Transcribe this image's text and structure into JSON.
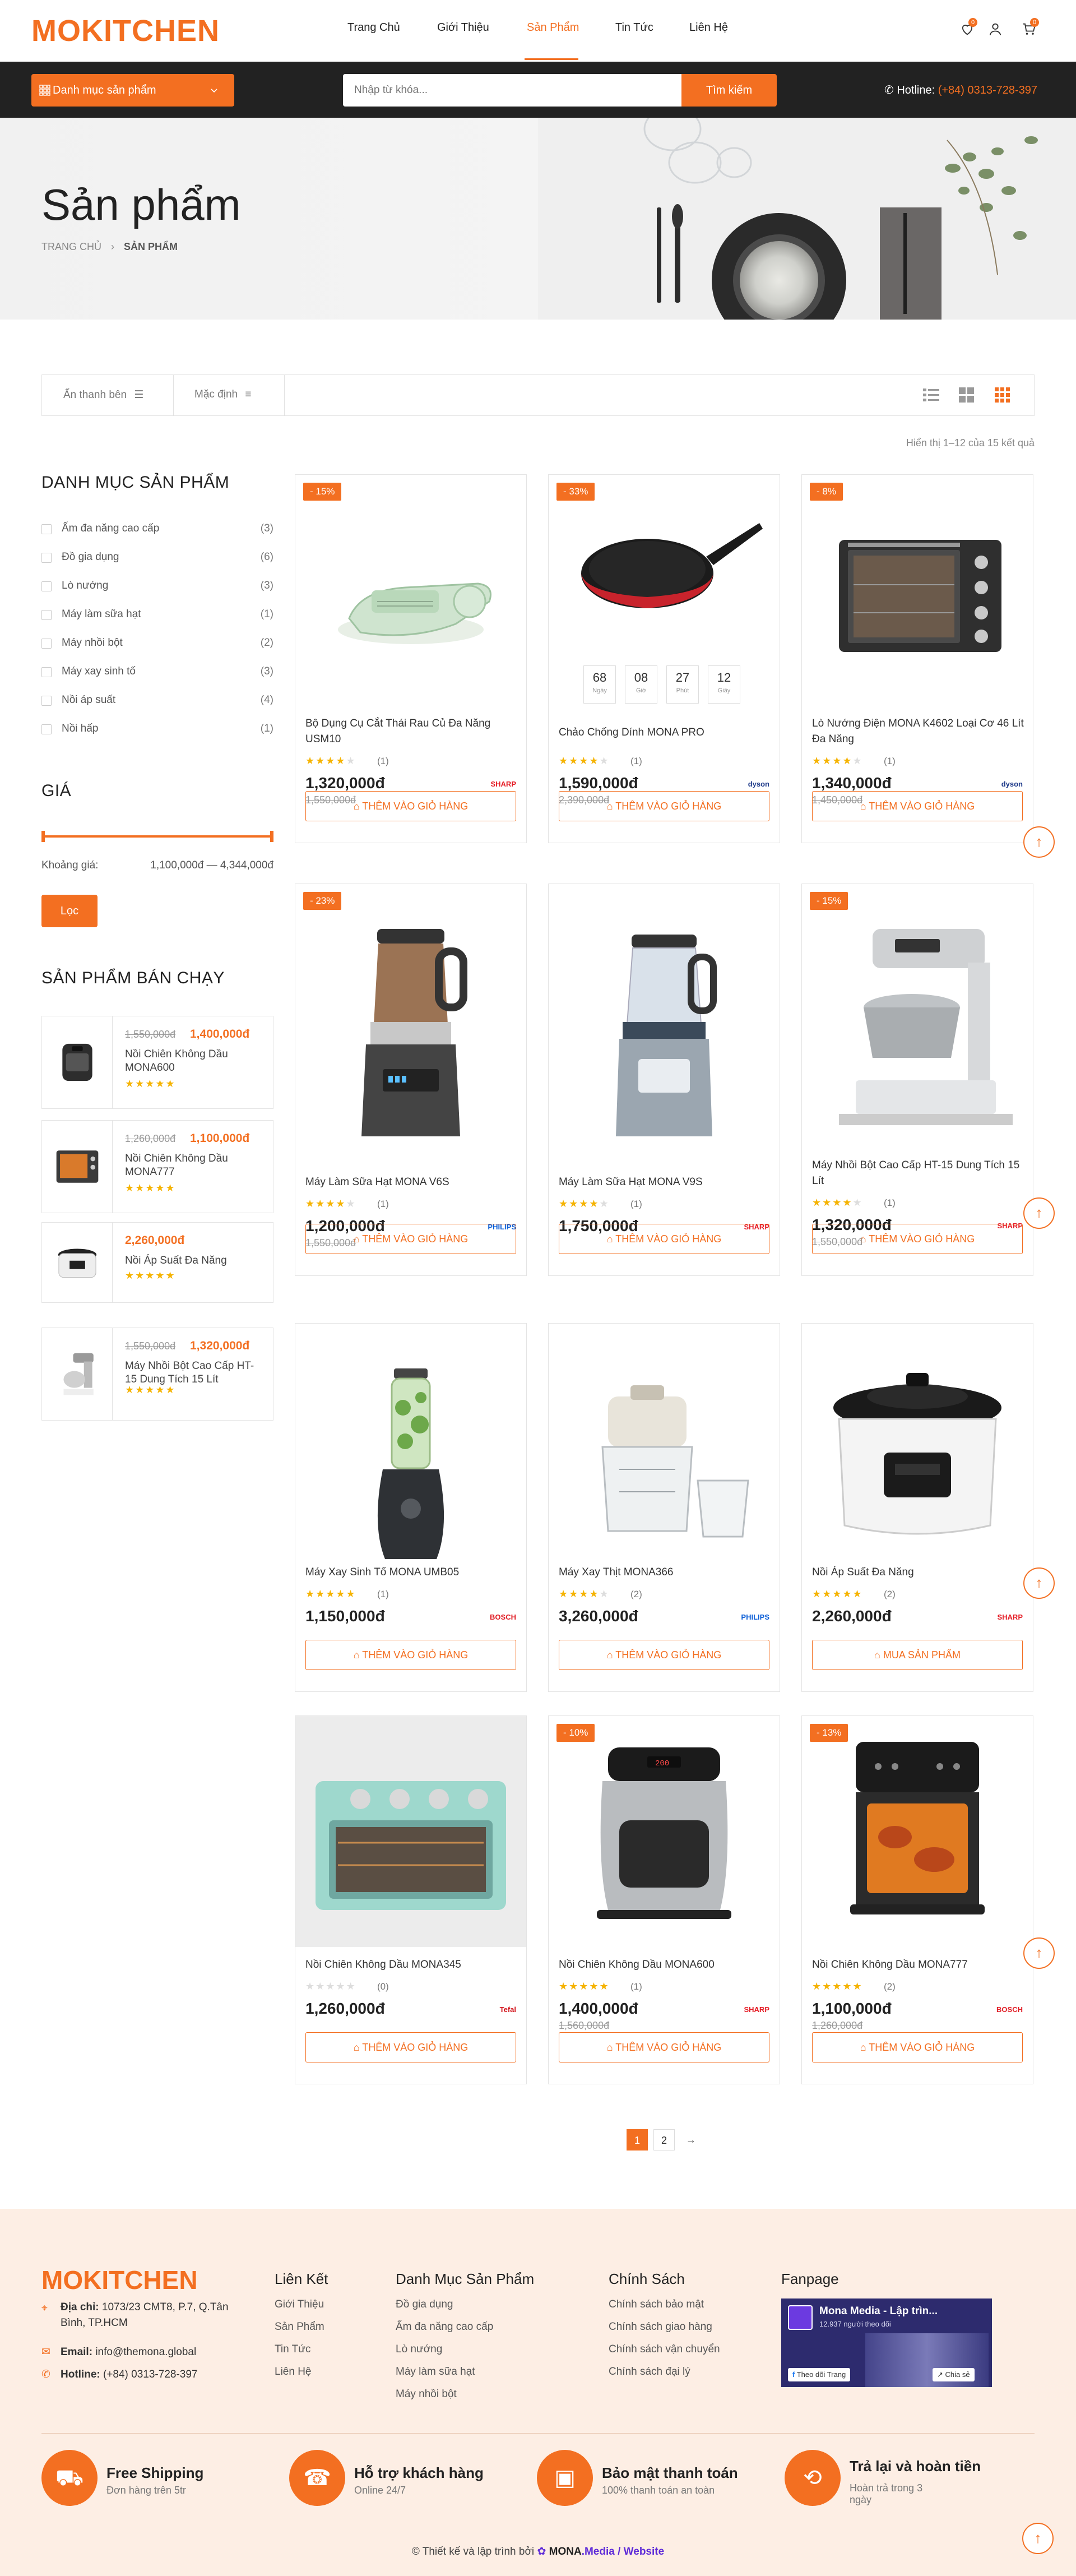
{
  "header": {
    "logo": "MOKITCHEN",
    "nav": [
      "Trang Chủ",
      "Giới Thiệu",
      "Sản Phẩm",
      "Tin Tức",
      "Liên Hệ"
    ],
    "wishlist_count": "0",
    "cart_count": "0"
  },
  "bar": {
    "category_button": "Danh mục sản phẩm",
    "search_placeholder": "Nhập từ khóa...",
    "search_button": "Tìm kiếm",
    "hotline_label": "Hotline:",
    "hotline_value": "(+84) 0313-728-397"
  },
  "hero": {
    "title": "Sản phẩm",
    "breadcrumb_home": "TRANG CHỦ",
    "breadcrumb_current": "SẢN PHẨM"
  },
  "toolbar": {
    "hide_sidebar": "Ẩn thanh bên",
    "sort": "Mặc định",
    "showing": "Hiển thị 1–12 của 15 kết quả"
  },
  "sidebar": {
    "categories_title": "DANH MỤC SẢN PHẨM",
    "categories": [
      {
        "name": "Ấm đa năng cao cấp",
        "count": "(3)"
      },
      {
        "name": "Đồ gia dụng",
        "count": "(6)"
      },
      {
        "name": "Lò nướng",
        "count": "(3)"
      },
      {
        "name": "Máy làm sữa hạt",
        "count": "(1)"
      },
      {
        "name": "Máy nhồi bột",
        "count": "(2)"
      },
      {
        "name": "Máy xay sinh tố",
        "count": "(3)"
      },
      {
        "name": "Nồi áp suất",
        "count": "(4)"
      },
      {
        "name": "Nồi hấp",
        "count": "(1)"
      }
    ],
    "price_title": "GIÁ",
    "price_label": "Khoảng giá:",
    "price_range": "1,100,000đ — 4,344,000đ",
    "filter_button": "Lọc",
    "bestsellers_title": "SẢN PHẨM BÁN CHẠY",
    "bestsellers": [
      {
        "old": "1,550,000đ",
        "price": "1,400,000đ",
        "name": "Nồi Chiên Không Dầu MONA600",
        "rating": 5
      },
      {
        "old": "1,260,000đ",
        "price": "1,100,000đ",
        "name": "Nồi Chiên Không Dầu MONA777",
        "rating": 5
      },
      {
        "old": "",
        "price": "2,260,000đ",
        "name": "Nồi Áp Suất Đa Năng",
        "rating": 5
      },
      {
        "old": "1,550,000đ",
        "price": "1,320,000đ",
        "name": "Máy Nhồi Bột Cao Cấp HT-15 Dung Tích 15 Lít",
        "rating": 4
      }
    ]
  },
  "products": [
    {
      "discount": "- 15%",
      "name": "Bộ Dụng Cụ Cắt Thái Rau Củ Đa Năng USM10",
      "rating": 4,
      "reviews": "(1)",
      "price": "1,320,000đ",
      "old": "1,550,000đ",
      "brand": "SHARP",
      "button": "THÊM VÀO GIỎ HÀNG"
    },
    {
      "discount": "- 33%",
      "name": "Chảo Chống Dính MONA PRO",
      "rating": 4,
      "reviews": "(1)",
      "price": "1,590,000đ",
      "old": "2,390,000đ",
      "brand": "dyson",
      "button": "THÊM VÀO GIỎ HÀNG",
      "countdown": [
        {
          "v": "68",
          "l": "Ngày"
        },
        {
          "v": "08",
          "l": "Giờ"
        },
        {
          "v": "27",
          "l": "Phút"
        },
        {
          "v": "12",
          "l": "Giây"
        }
      ]
    },
    {
      "discount": "- 8%",
      "name": "Lò Nướng Điện MONA K4602 Loại Cơ 46 Lít Đa Năng",
      "rating": 4,
      "reviews": "(1)",
      "price": "1,340,000đ",
      "old": "1,450,000đ",
      "brand": "dyson",
      "button": "THÊM VÀO GIỎ HÀNG"
    },
    {
      "discount": "- 23%",
      "name": "Máy Làm Sữa Hạt MONA V6S",
      "rating": 4,
      "reviews": "(1)",
      "price": "1,200,000đ",
      "old": "1,550,000đ",
      "brand": "PHILIPS",
      "button": "THÊM VÀO GIỎ HÀNG"
    },
    {
      "discount": "",
      "name": "Máy Làm Sữa Hạt MONA V9S",
      "rating": 4,
      "reviews": "(1)",
      "price": "1,750,000đ",
      "old": "",
      "brand": "SHARP",
      "button": "THÊM VÀO GIỎ HÀNG"
    },
    {
      "discount": "- 15%",
      "name": "Máy Nhồi Bột Cao Cấp HT-15 Dung Tích 15 Lít",
      "rating": 4,
      "reviews": "(1)",
      "price": "1,320,000đ",
      "old": "1,550,000đ",
      "brand": "SHARP",
      "button": "THÊM VÀO GIỎ HÀNG"
    },
    {
      "discount": "",
      "name": "Máy Xay Sinh Tố MONA UMB05",
      "rating": 5,
      "reviews": "(1)",
      "price": "1,150,000đ",
      "old": "",
      "brand": "BOSCH",
      "button": "THÊM VÀO GIỎ HÀNG"
    },
    {
      "discount": "",
      "name": "Máy Xay Thịt MONA366",
      "rating": 4,
      "reviews": "(2)",
      "price": "3,260,000đ",
      "old": "",
      "brand": "PHILIPS",
      "button": "THÊM VÀO GIỎ HÀNG"
    },
    {
      "discount": "",
      "name": "Nồi Áp Suất Đa Năng",
      "rating": 5,
      "reviews": "(2)",
      "price": "2,260,000đ",
      "old": "",
      "brand": "SHARP",
      "button": "MUA SẢN PHẨM"
    },
    {
      "discount": "",
      "name": "Nồi Chiên Không Dầu MONA345",
      "rating": 0,
      "reviews": "(0)",
      "price": "1,260,000đ",
      "old": "",
      "brand": "Tefal",
      "button": "THÊM VÀO GIỎ HÀNG"
    },
    {
      "discount": "- 10%",
      "name": "Nồi Chiên Không Dầu MONA600",
      "rating": 5,
      "reviews": "(1)",
      "price": "1,400,000đ",
      "old": "1,560,000đ",
      "brand": "SHARP",
      "button": "THÊM VÀO GIỎ HÀNG"
    },
    {
      "discount": "- 13%",
      "name": "Nồi Chiên Không Dầu MONA777",
      "rating": 5,
      "reviews": "(2)",
      "price": "1,100,000đ",
      "old": "1,260,000đ",
      "brand": "BOSCH",
      "button": "THÊM VÀO GIỎ HÀNG"
    }
  ],
  "pagination": {
    "pages": [
      "1",
      "2"
    ],
    "next": "→"
  },
  "footer": {
    "logo": "MOKITCHEN",
    "address_label": "Địa chỉ:",
    "address": "1073/23 CMT8, P.7, Q.Tân Bình, TP.HCM",
    "email_label": "Email:",
    "email": "info@themona.global",
    "hotline_label": "Hotline:",
    "hotline": "(+84) 0313-728-397",
    "col_links_title": "Liên Kết",
    "col_links": [
      "Giới Thiệu",
      "Sản Phẩm",
      "Tin Tức",
      "Liên Hệ"
    ],
    "col_cat_title": "Danh Mục Sản Phẩm",
    "col_cat": [
      "Đồ gia dụng",
      "Ấm đa năng cao cấp",
      "Lò nướng",
      "Máy làm sữa hạt",
      "Máy nhồi bột"
    ],
    "col_policy_title": "Chính Sách",
    "col_policy": [
      "Chính sách bảo mật",
      "Chính sách giao hàng",
      "Chính sách vận chuyển",
      "Chính sách đại lý"
    ],
    "fanpage_title": "Fanpage",
    "fanpage_name": "Mona Media - Lập trìn...",
    "fanpage_followers": "12.937 người theo dõi",
    "fanpage_follow": "Theo dõi Trang",
    "fanpage_share": "Chia sẻ",
    "services": [
      {
        "title": "Free Shipping",
        "sub": "Đơn hàng trên 5tr"
      },
      {
        "title": "Hỗ trợ khách hàng",
        "sub": "Online 24/7"
      },
      {
        "title": "Bảo mật thanh toán",
        "sub": "100% thanh toán an toàn"
      },
      {
        "title": "Trả lại và hoàn tiền",
        "sub": "Hoàn trả trong 3 ngày"
      }
    ],
    "copyright_prefix": "© Thiết kế và lập trình bởi",
    "copyright_brand": "MONA",
    "copyright_suffix": ".Media / Website"
  },
  "colors": {
    "accent": "#f36f21",
    "dark_bar": "#222222",
    "footer_bg": "#fdeee4",
    "stars": "#f5b301"
  }
}
